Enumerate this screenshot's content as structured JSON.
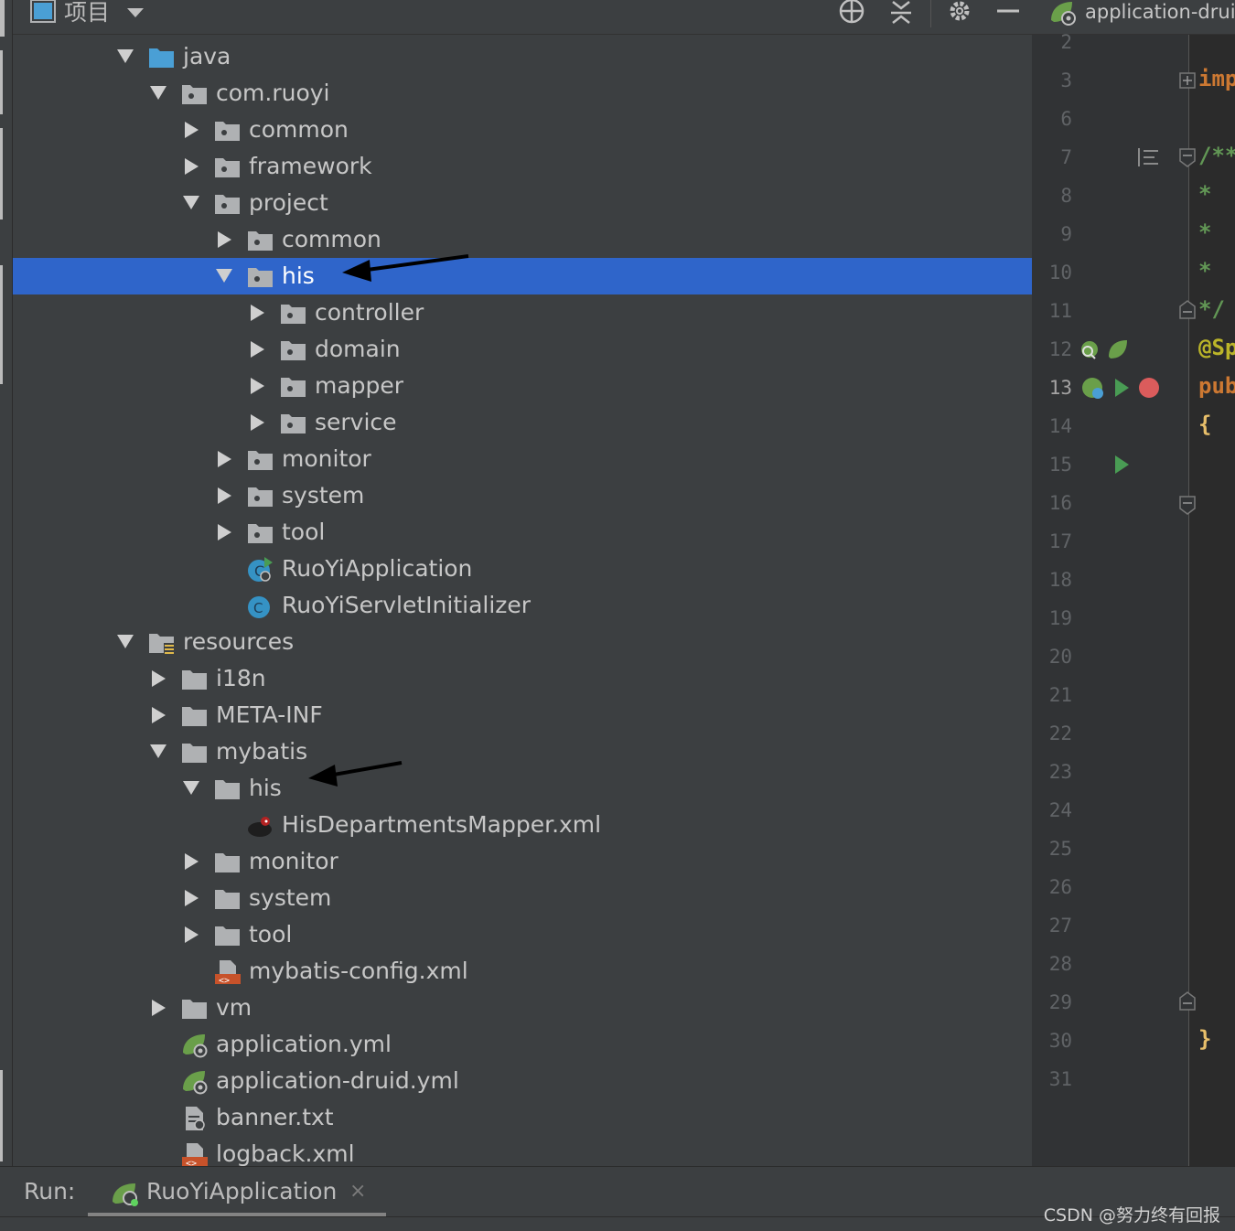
{
  "project_panel": {
    "title": "项目",
    "tree": [
      {
        "label": "java",
        "level": 0,
        "expand": "down",
        "icon": "source-folder-icon"
      },
      {
        "label": "com.ruoyi",
        "level": 1,
        "expand": "down",
        "icon": "package-icon"
      },
      {
        "label": "common",
        "level": 2,
        "expand": "right",
        "icon": "package-icon"
      },
      {
        "label": "framework",
        "level": 2,
        "expand": "right",
        "icon": "package-icon"
      },
      {
        "label": "project",
        "level": 2,
        "expand": "down",
        "icon": "package-icon"
      },
      {
        "label": "common",
        "level": 3,
        "expand": "right",
        "icon": "package-icon"
      },
      {
        "label": "his",
        "level": 3,
        "expand": "down",
        "icon": "package-icon",
        "selected": true
      },
      {
        "label": "controller",
        "level": 4,
        "expand": "right",
        "icon": "package-icon"
      },
      {
        "label": "domain",
        "level": 4,
        "expand": "right",
        "icon": "package-icon"
      },
      {
        "label": "mapper",
        "level": 4,
        "expand": "right",
        "icon": "package-icon"
      },
      {
        "label": "service",
        "level": 4,
        "expand": "right",
        "icon": "package-icon"
      },
      {
        "label": "monitor",
        "level": 3,
        "expand": "right",
        "icon": "package-icon"
      },
      {
        "label": "system",
        "level": 3,
        "expand": "right",
        "icon": "package-icon"
      },
      {
        "label": "tool",
        "level": 3,
        "expand": "right",
        "icon": "package-icon"
      },
      {
        "label": "RuoYiApplication",
        "level": 3,
        "expand": "none",
        "icon": "spring-boot-class-icon"
      },
      {
        "label": "RuoYiServletInitializer",
        "level": 3,
        "expand": "none",
        "icon": "class-icon"
      },
      {
        "label": "resources",
        "level": 0,
        "expand": "down",
        "icon": "resources-folder-icon"
      },
      {
        "label": "i18n",
        "level": 1,
        "expand": "right",
        "icon": "folder-icon"
      },
      {
        "label": "META-INF",
        "level": 1,
        "expand": "right",
        "icon": "folder-icon"
      },
      {
        "label": "mybatis",
        "level": 1,
        "expand": "down",
        "icon": "folder-icon"
      },
      {
        "label": "his",
        "level": 2,
        "expand": "down",
        "icon": "folder-icon"
      },
      {
        "label": "HisDepartmentsMapper.xml",
        "level": 3,
        "expand": "none",
        "icon": "mybatis-xml-icon"
      },
      {
        "label": "monitor",
        "level": 2,
        "expand": "right",
        "icon": "folder-icon"
      },
      {
        "label": "system",
        "level": 2,
        "expand": "right",
        "icon": "folder-icon"
      },
      {
        "label": "tool",
        "level": 2,
        "expand": "right",
        "icon": "folder-icon"
      },
      {
        "label": "mybatis-config.xml",
        "level": 2,
        "expand": "none",
        "icon": "xml-file-icon"
      },
      {
        "label": "vm",
        "level": 1,
        "expand": "right",
        "icon": "folder-icon"
      },
      {
        "label": "application.yml",
        "level": 1,
        "expand": "none",
        "icon": "spring-yml-icon"
      },
      {
        "label": "application-druid.yml",
        "level": 1,
        "expand": "none",
        "icon": "spring-yml-icon"
      },
      {
        "label": "banner.txt",
        "level": 1,
        "expand": "none",
        "icon": "text-file-icon"
      },
      {
        "label": "logback.xml",
        "level": 1,
        "expand": "none",
        "icon": "xml-file-icon"
      }
    ]
  },
  "editor": {
    "tab_label": "application-druid",
    "line_numbers": [
      "2",
      "3",
      "6",
      "7",
      "8",
      "9",
      "10",
      "11",
      "12",
      "13",
      "14",
      "15",
      "16",
      "17",
      "18",
      "19",
      "20",
      "21",
      "22",
      "23",
      "24",
      "25",
      "26",
      "27",
      "28",
      "29",
      "30",
      "31"
    ],
    "current_line": "13",
    "fragments": [
      {
        "line": "3",
        "text": "imp",
        "color": "#cc7832"
      },
      {
        "line": "7",
        "text": "/**",
        "color": "#629755"
      },
      {
        "line": "8",
        "text": " *",
        "color": "#629755"
      },
      {
        "line": "9",
        "text": " *",
        "color": "#629755"
      },
      {
        "line": "10",
        "text": " *",
        "color": "#629755"
      },
      {
        "line": "11",
        "text": " */",
        "color": "#629755"
      },
      {
        "line": "12",
        "text": "@Sp",
        "color": "#bbb529"
      },
      {
        "line": "13",
        "text": "pub",
        "color": "#cc7832"
      },
      {
        "line": "14",
        "text": "{",
        "color": "#e8bf6a"
      },
      {
        "line": "30",
        "text": "}",
        "color": "#e8bf6a"
      }
    ]
  },
  "run_bar": {
    "label": "Run:",
    "tab_label": "RuoYiApplication",
    "close": "×"
  },
  "watermark": "CSDN @努力终有回报",
  "colors": {
    "selection": "#2f65ca",
    "panel_bg": "#3c3f41",
    "gutter_bg": "#313335",
    "folder": "#afb1b3",
    "source_folder": "#4a9fd5"
  }
}
